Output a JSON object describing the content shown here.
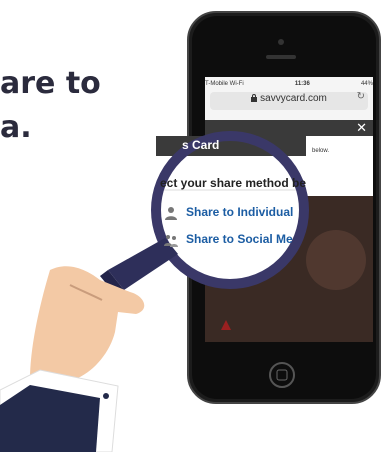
{
  "headline": {
    "line1": "are to",
    "line2": "a."
  },
  "phone": {
    "status": {
      "carrier": "T-Mobile Wi-Fi",
      "time": "11:36",
      "battery": "44%"
    },
    "url": "savvycard.com",
    "modal": {
      "header_partial": "Sh... ...rd",
      "title": "s Card",
      "instruction_tail": "below.",
      "instruction": "ect your share method be",
      "options": [
        {
          "label": "Share to Individual",
          "icon": "person-icon"
        },
        {
          "label": "Share to Social Me",
          "icon": "people-icon"
        }
      ]
    }
  },
  "colors": {
    "headline": "#2b2b3d",
    "link": "#1c5da3",
    "magnifier_rim": "#3a3868",
    "sleeve": "#232a4a"
  }
}
